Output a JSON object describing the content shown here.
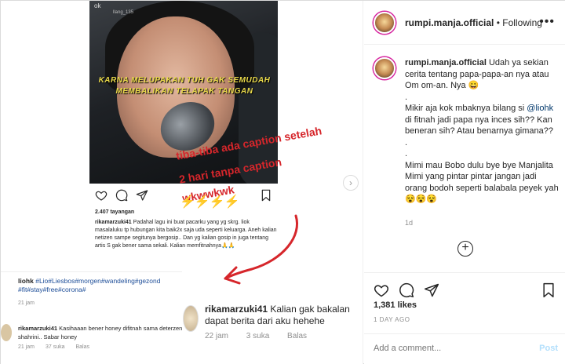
{
  "story": {
    "handle": "ok",
    "handle_sub": "llang_135",
    "subtitle_line1": "KARNA MELUPAKAN TUH GAK SEMUDAH",
    "subtitle_line2": "MEMBALIKAN TELAPAK TANGAN"
  },
  "annotation": {
    "line1": "tiba-tiba ada caption setelah",
    "line2": "2 hari tanpa caption",
    "line3": "wkwwkwk",
    "bolts": "⚡⚡⚡⚡"
  },
  "inner_post": {
    "likes": "2.407 tayangan",
    "username": "rikamarzuki41",
    "caption": "Padahal lagu ini buat pacarku yang yg skrg. liok masalaluku tp hubungan kita baik2x saja uda seperti keluarga. Aneh kalian netizen sampe segitunya bergosip.. Dan yg kalian gosip in juga tentang artis S gak bener sama sekali. Kalian memfitnahnya🙏🙏"
  },
  "comment_liohk": {
    "username": "liohk",
    "text": "#Lio#Liesbos#morgen#wandeling#gezond #fit#stay#free#corona#",
    "time": "21 jam"
  },
  "comment_rika_small": {
    "username": "rikamarzuki41",
    "text": "Kasihaaan bener honey difitnah sama deterzen shahrini.. Sabar honey",
    "time": "21 jam",
    "likes": "37 suka",
    "reply": "Balas"
  },
  "comment_rika_big": {
    "username": "rikamarzuki41",
    "text": "Kalian gak bakalan dapat berita dari aku hehehe",
    "time": "22 jam",
    "likes": "3 suka",
    "reply": "Balas"
  },
  "header": {
    "username": "rumpi.manja.official",
    "separator": "•",
    "follow_status": "Following",
    "more": "•••"
  },
  "caption": {
    "username": "rumpi.manja.official",
    "para1": "Udah ya sekian cerita tentang papa-papa-an nya atau Om om-an. Nya 😀",
    "dot1": ".",
    "para2_pre": "Mikir aja kok mbaknya bilang si",
    "mention": "@liohk",
    "para2_post": "di fitnah jadi papa nya inces sih?? Kan beneran sih? Atau benarnya gimana??",
    "dot2": ".",
    "dot3": ".",
    "para3": "Mimi mau Bobo dulu bye bye Manjalita Mimi yang pintar pintar jangan jadi orang bodoh seperti balabala peyek yah 😵😵😵",
    "time": "1d"
  },
  "post_stats": {
    "likes": "1,381 likes",
    "date": "1 DAY AGO"
  },
  "add_comment": {
    "placeholder": "Add a comment...",
    "post_label": "Post"
  },
  "icons": {
    "like": "heart-icon",
    "comment": "comment-icon",
    "share": "share-icon",
    "save": "bookmark-icon",
    "next": "chevron-right-icon",
    "more": "more-icon",
    "load_more": "plus-circle-icon"
  },
  "colors": {
    "annotation_red": "#d6262b",
    "mention_blue": "#00376b",
    "post_button": "#b2dffc"
  }
}
